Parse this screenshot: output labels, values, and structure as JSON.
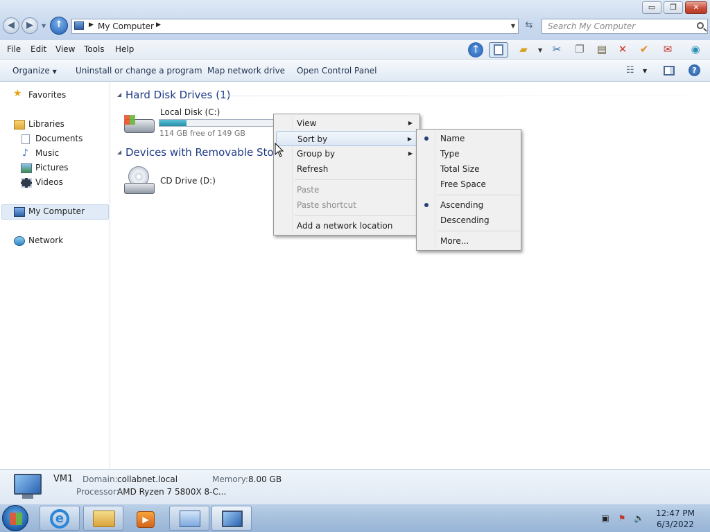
{
  "window": {
    "caption_buttons": {
      "minimize": "▭",
      "maximize": "❐",
      "close": "✕"
    }
  },
  "address": {
    "path": "My Computer",
    "search_placeholder": "Search My Computer"
  },
  "menu": [
    "File",
    "Edit",
    "View",
    "Tools",
    "Help"
  ],
  "toolbar_icons": [
    "up-arrow-icon",
    "view-pane-icon",
    "folder-check-icon",
    "scissors-icon",
    "copy-icon",
    "paste-icon",
    "delete-icon",
    "checkmark-icon",
    "mail-icon",
    "globe-icon"
  ],
  "command_bar": {
    "organize": "Organize",
    "uninstall": "Uninstall or change a program",
    "map_drive": "Map network drive",
    "control_panel": "Open Control Panel"
  },
  "nav": {
    "favorites": "Favorites",
    "libraries": "Libraries",
    "documents": "Documents",
    "music": "Music",
    "pictures": "Pictures",
    "videos": "Videos",
    "my_computer": "My Computer",
    "network": "Network"
  },
  "content": {
    "hdd_group": "Hard Disk Drives (1)",
    "local_disk": {
      "name": "Local Disk (C:)",
      "free": "114 GB free of 149 GB",
      "used_fraction": 0.235
    },
    "removable_group": "Devices with Removable Storage",
    "cd_drive": "CD Drive (D:)"
  },
  "context_menu": {
    "view": "View",
    "sort_by": "Sort by",
    "group_by": "Group by",
    "refresh": "Refresh",
    "paste": "Paste",
    "paste_shortcut": "Paste shortcut",
    "add_network": "Add a network location"
  },
  "sort_menu": {
    "name": "Name",
    "type": "Type",
    "total_size": "Total Size",
    "free_space": "Free Space",
    "ascending": "Ascending",
    "descending": "Descending",
    "more": "More...",
    "selected_field": "Name",
    "selected_order": "Ascending"
  },
  "details": {
    "computer_name": "VM1",
    "domain_label": "Domain:",
    "domain": "collabnet.local",
    "memory_label": "Memory:",
    "memory": "8.00 GB",
    "processor_label": "Processor:",
    "processor": "AMD Ryzen 7 5800X 8-C..."
  },
  "taskbar": {
    "time": "12:47 PM",
    "date": "6/3/2022",
    "apps": [
      "internet-explorer-icon",
      "file-explorer-icon",
      "media-player-icon",
      "control-panel-icon",
      "my-computer-icon"
    ]
  },
  "colors": {
    "accent": "#1e3a87",
    "selection": "#e1ebf7",
    "taskbar": "#a9c2de"
  }
}
